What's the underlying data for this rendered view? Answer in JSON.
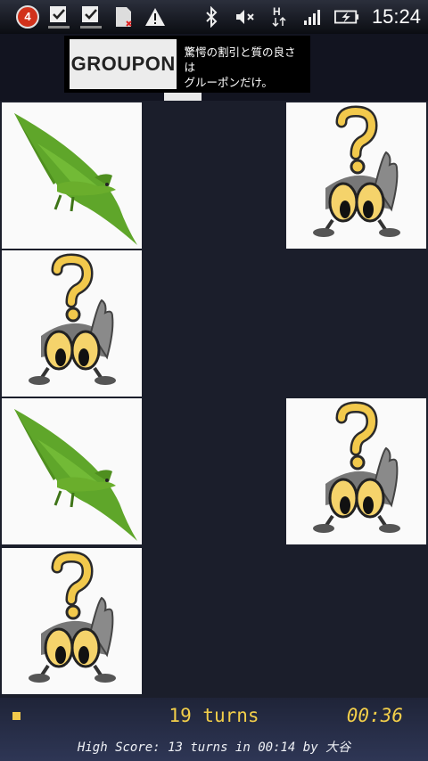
{
  "status_bar": {
    "notification_count": "4",
    "time": "15:24",
    "icons": [
      "back-arrow-icon",
      "download-done-icon",
      "download-done-icon",
      "sd-card-icon",
      "warning-icon",
      "bluetooth-icon",
      "mute-icon",
      "h-data-icon",
      "signal-icon",
      "battery-charging-icon"
    ]
  },
  "ad": {
    "brand": "GROUPON",
    "line1": "驚愕の割引と質の良さは",
    "line2": "グルーポンだけ。"
  },
  "board": {
    "cards": [
      {
        "face": "pterodactyl"
      },
      {
        "face": "question-character"
      },
      {
        "face": "question-character"
      },
      {
        "face": "pterodactyl"
      },
      {
        "face": "question-character"
      },
      {
        "face": "question-character"
      }
    ]
  },
  "footer": {
    "turns_text": "19 turns",
    "timer_text": "00:36",
    "high_score_text": "High Score: 13 turns in 00:14 by 大谷",
    "accent_color": "#f3cf4a"
  }
}
